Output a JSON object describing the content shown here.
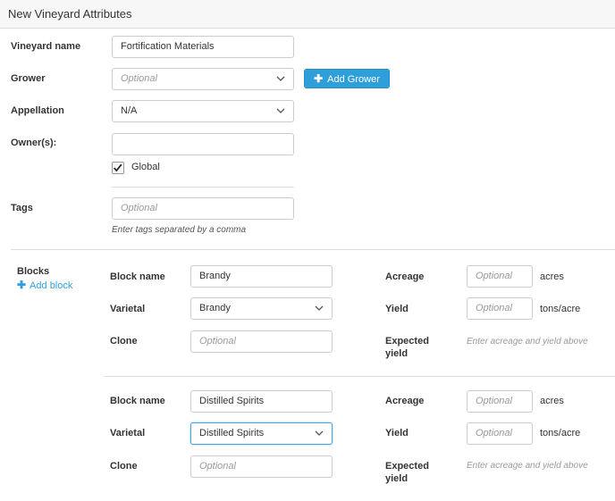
{
  "header": {
    "title": "New Vineyard Attributes"
  },
  "form": {
    "vineyard_name": {
      "label": "Vineyard name",
      "value": "Fortification Materials"
    },
    "grower": {
      "label": "Grower",
      "placeholder": "Optional",
      "add_button": "Add Grower"
    },
    "appellation": {
      "label": "Appellation",
      "value": "N/A"
    },
    "owners": {
      "label": "Owner(s):",
      "value": "",
      "global_label": "Global",
      "global_checked": true
    },
    "tags": {
      "label": "Tags",
      "placeholder": "Optional",
      "hint": "Enter tags separated by a comma"
    }
  },
  "blocks": {
    "label": "Blocks",
    "add_label": "Add block",
    "items": [
      {
        "block_name_label": "Block name",
        "block_name": "Brandy",
        "varietal_label": "Varietal",
        "varietal": "Brandy",
        "clone_label": "Clone",
        "clone_placeholder": "Optional",
        "acreage_label": "Acreage",
        "acreage_placeholder": "Optional",
        "acreage_unit": "acres",
        "yield_label": "Yield",
        "yield_placeholder": "Optional",
        "yield_unit": "tons/acre",
        "expected_label_1": "Expected",
        "expected_label_2": "yield",
        "expected_hint": "Enter acreage and yield above"
      },
      {
        "block_name_label": "Block name",
        "block_name": "Distilled Spirits",
        "varietal_label": "Varietal",
        "varietal": "Distilled Spirits",
        "clone_label": "Clone",
        "clone_placeholder": "Optional",
        "acreage_label": "Acreage",
        "acreage_placeholder": "Optional",
        "acreage_unit": "acres",
        "yield_label": "Yield",
        "yield_placeholder": "Optional",
        "yield_unit": "tons/acre",
        "expected_label_1": "Expected",
        "expected_label_2": "yield",
        "expected_hint": "Enter acreage and yield above"
      }
    ]
  },
  "colors": {
    "accent": "#2e9fdb",
    "border": "#cccccc",
    "header_bg": "#f7f7f7"
  }
}
